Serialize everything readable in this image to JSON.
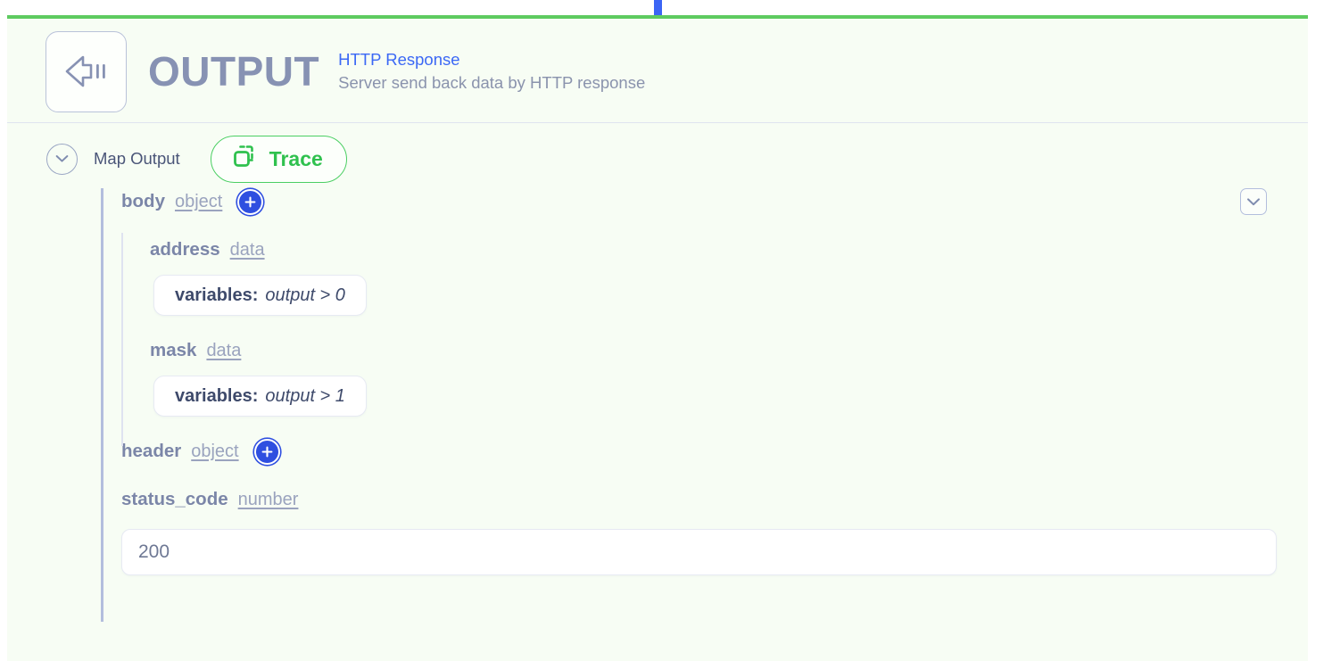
{
  "node": {
    "title": "OUTPUT",
    "type_label": "HTTP Response",
    "description": "Server send back data by HTTP response",
    "icon": "output-arrow-icon",
    "accent_color": "#5ecb60",
    "connector_color": "#3b65f5",
    "background": "#f7fdf4"
  },
  "toolbar": {
    "collapse_icon": "chevron-down-icon",
    "map_output_label": "Map Output",
    "trace": {
      "label": "Trace",
      "icon": "copy-squares-icon",
      "color": "#2fc14e"
    }
  },
  "panel": {
    "collapse_icon": "chevron-down-square-icon"
  },
  "fields": {
    "body": {
      "name": "body",
      "type": "object",
      "add_icon": "plus-circle-icon",
      "children": [
        {
          "name": "address",
          "type": "data",
          "variable": {
            "key": "variables:",
            "value": "output > 0"
          }
        },
        {
          "name": "mask",
          "type": "data",
          "variable": {
            "key": "variables:",
            "value": "output > 1"
          }
        }
      ]
    },
    "header": {
      "name": "header",
      "type": "object",
      "add_icon": "plus-circle-icon"
    },
    "status_code": {
      "name": "status_code",
      "type": "number",
      "value": "200",
      "placeholder": "200"
    }
  }
}
